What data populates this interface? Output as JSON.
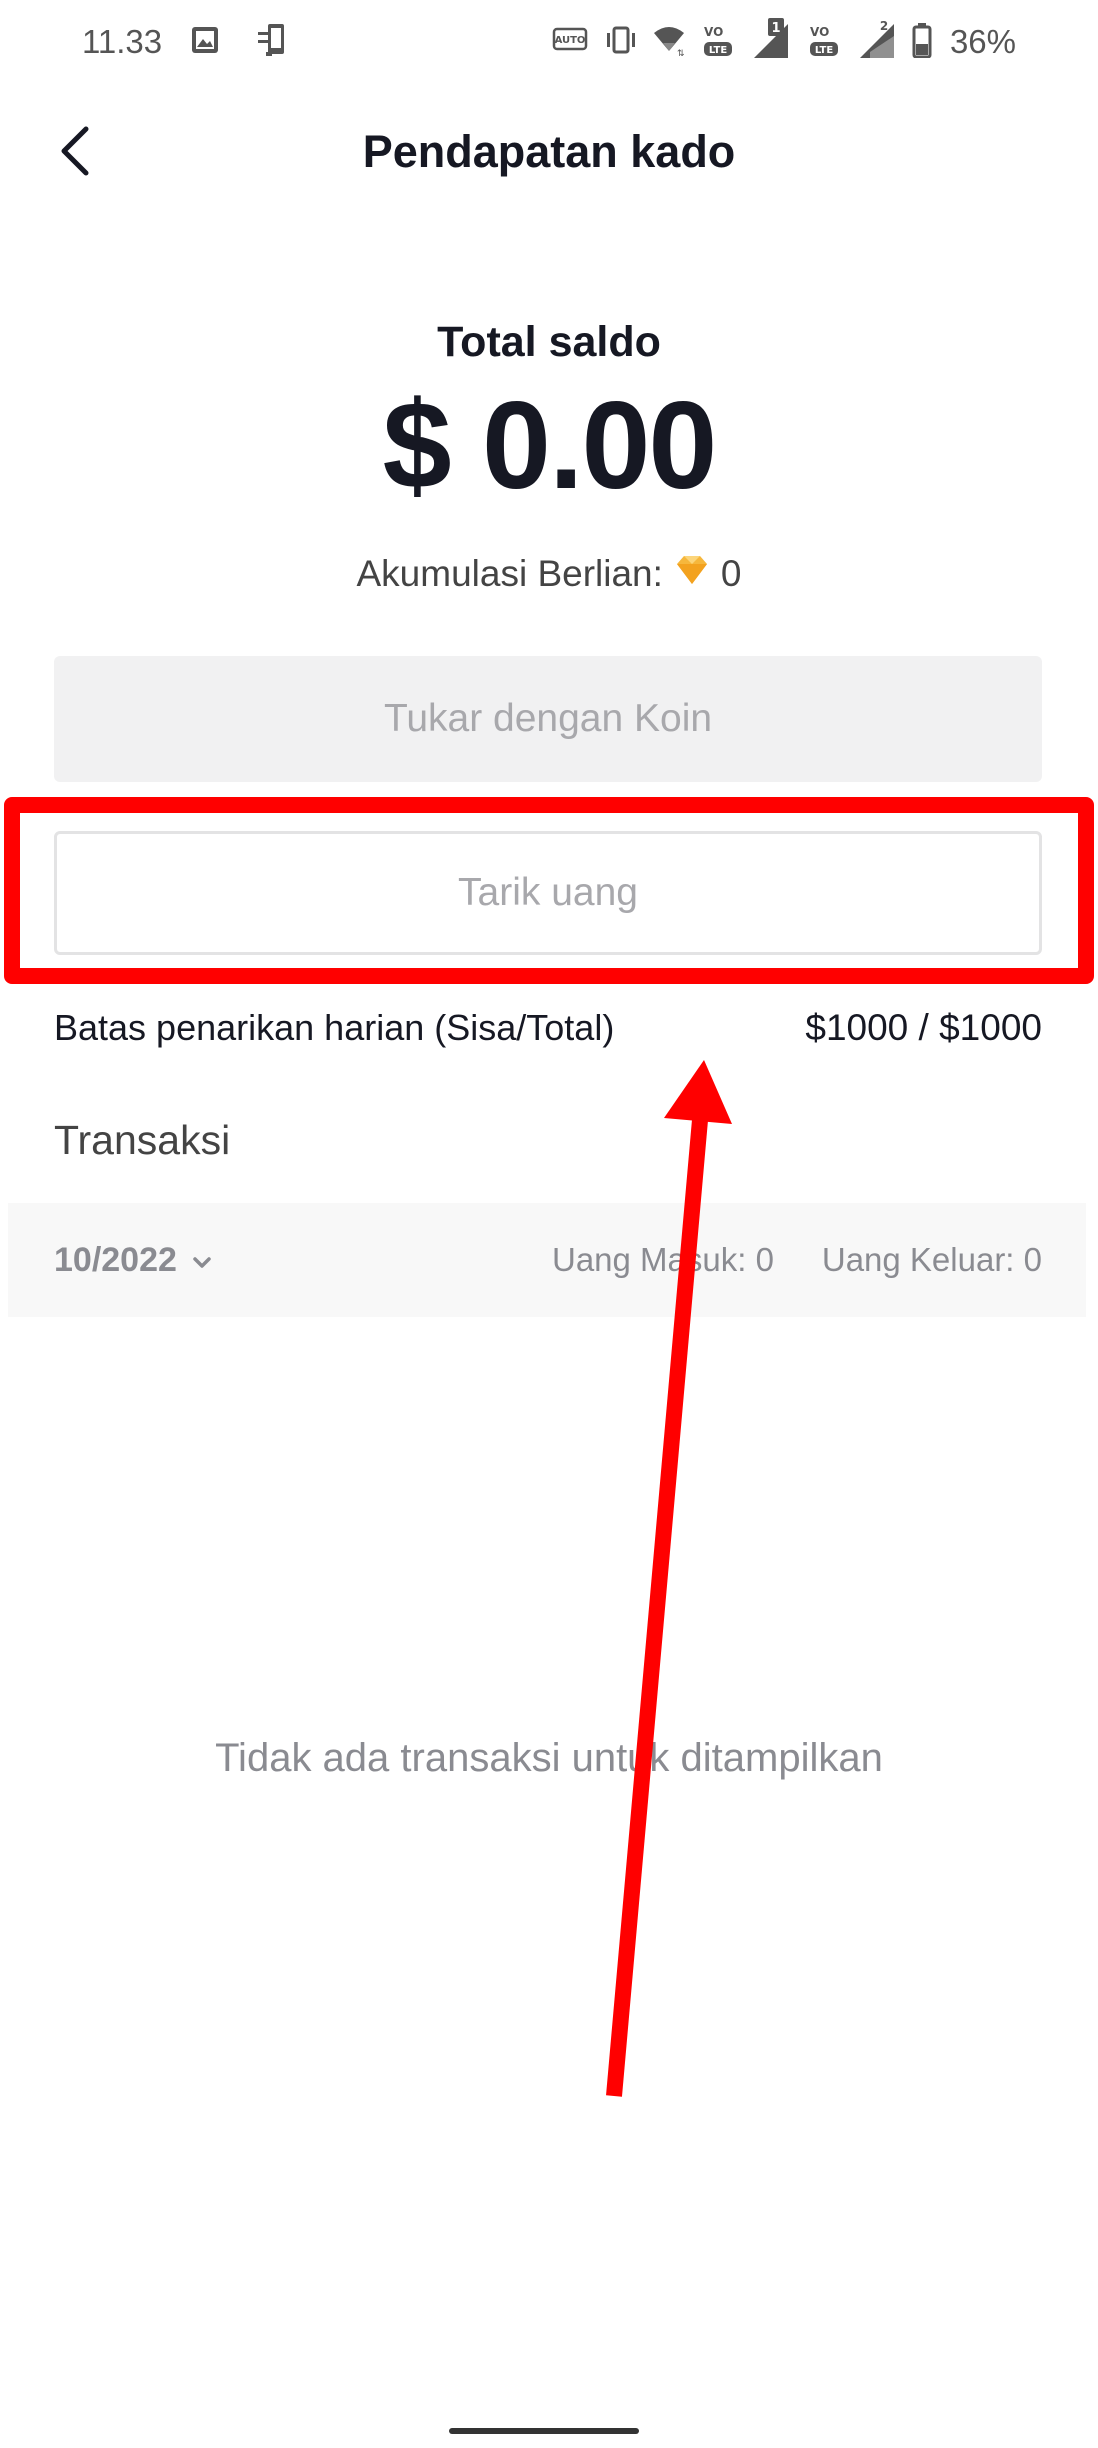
{
  "status_bar": {
    "time": "11.33",
    "battery_percent": "36%",
    "sim1_badge": "1",
    "sim2_badge": "2",
    "lte_label": "LTE",
    "volte_label": "VO",
    "auto_label": "AUTO"
  },
  "header": {
    "title": "Pendapatan kado"
  },
  "balance": {
    "label": "Total saldo",
    "amount": "$ 0.00",
    "diamonds_label": "Akumulasi Berlian:",
    "diamonds_count": "0"
  },
  "buttons": {
    "exchange_label": "Tukar dengan Koin",
    "withdraw_label": "Tarik uang"
  },
  "withdraw_limit": {
    "label": "Batas penarikan harian (Sisa/Total)",
    "value": "$1000 / $1000"
  },
  "transactions": {
    "title": "Transaksi",
    "month": "10/2022",
    "money_in": "Uang Masuk: 0",
    "money_out": "Uang Keluar: 0",
    "empty_message": "Tidak ada transaksi untuk ditampilkan"
  },
  "annotation": {
    "color": "#ff0000"
  }
}
